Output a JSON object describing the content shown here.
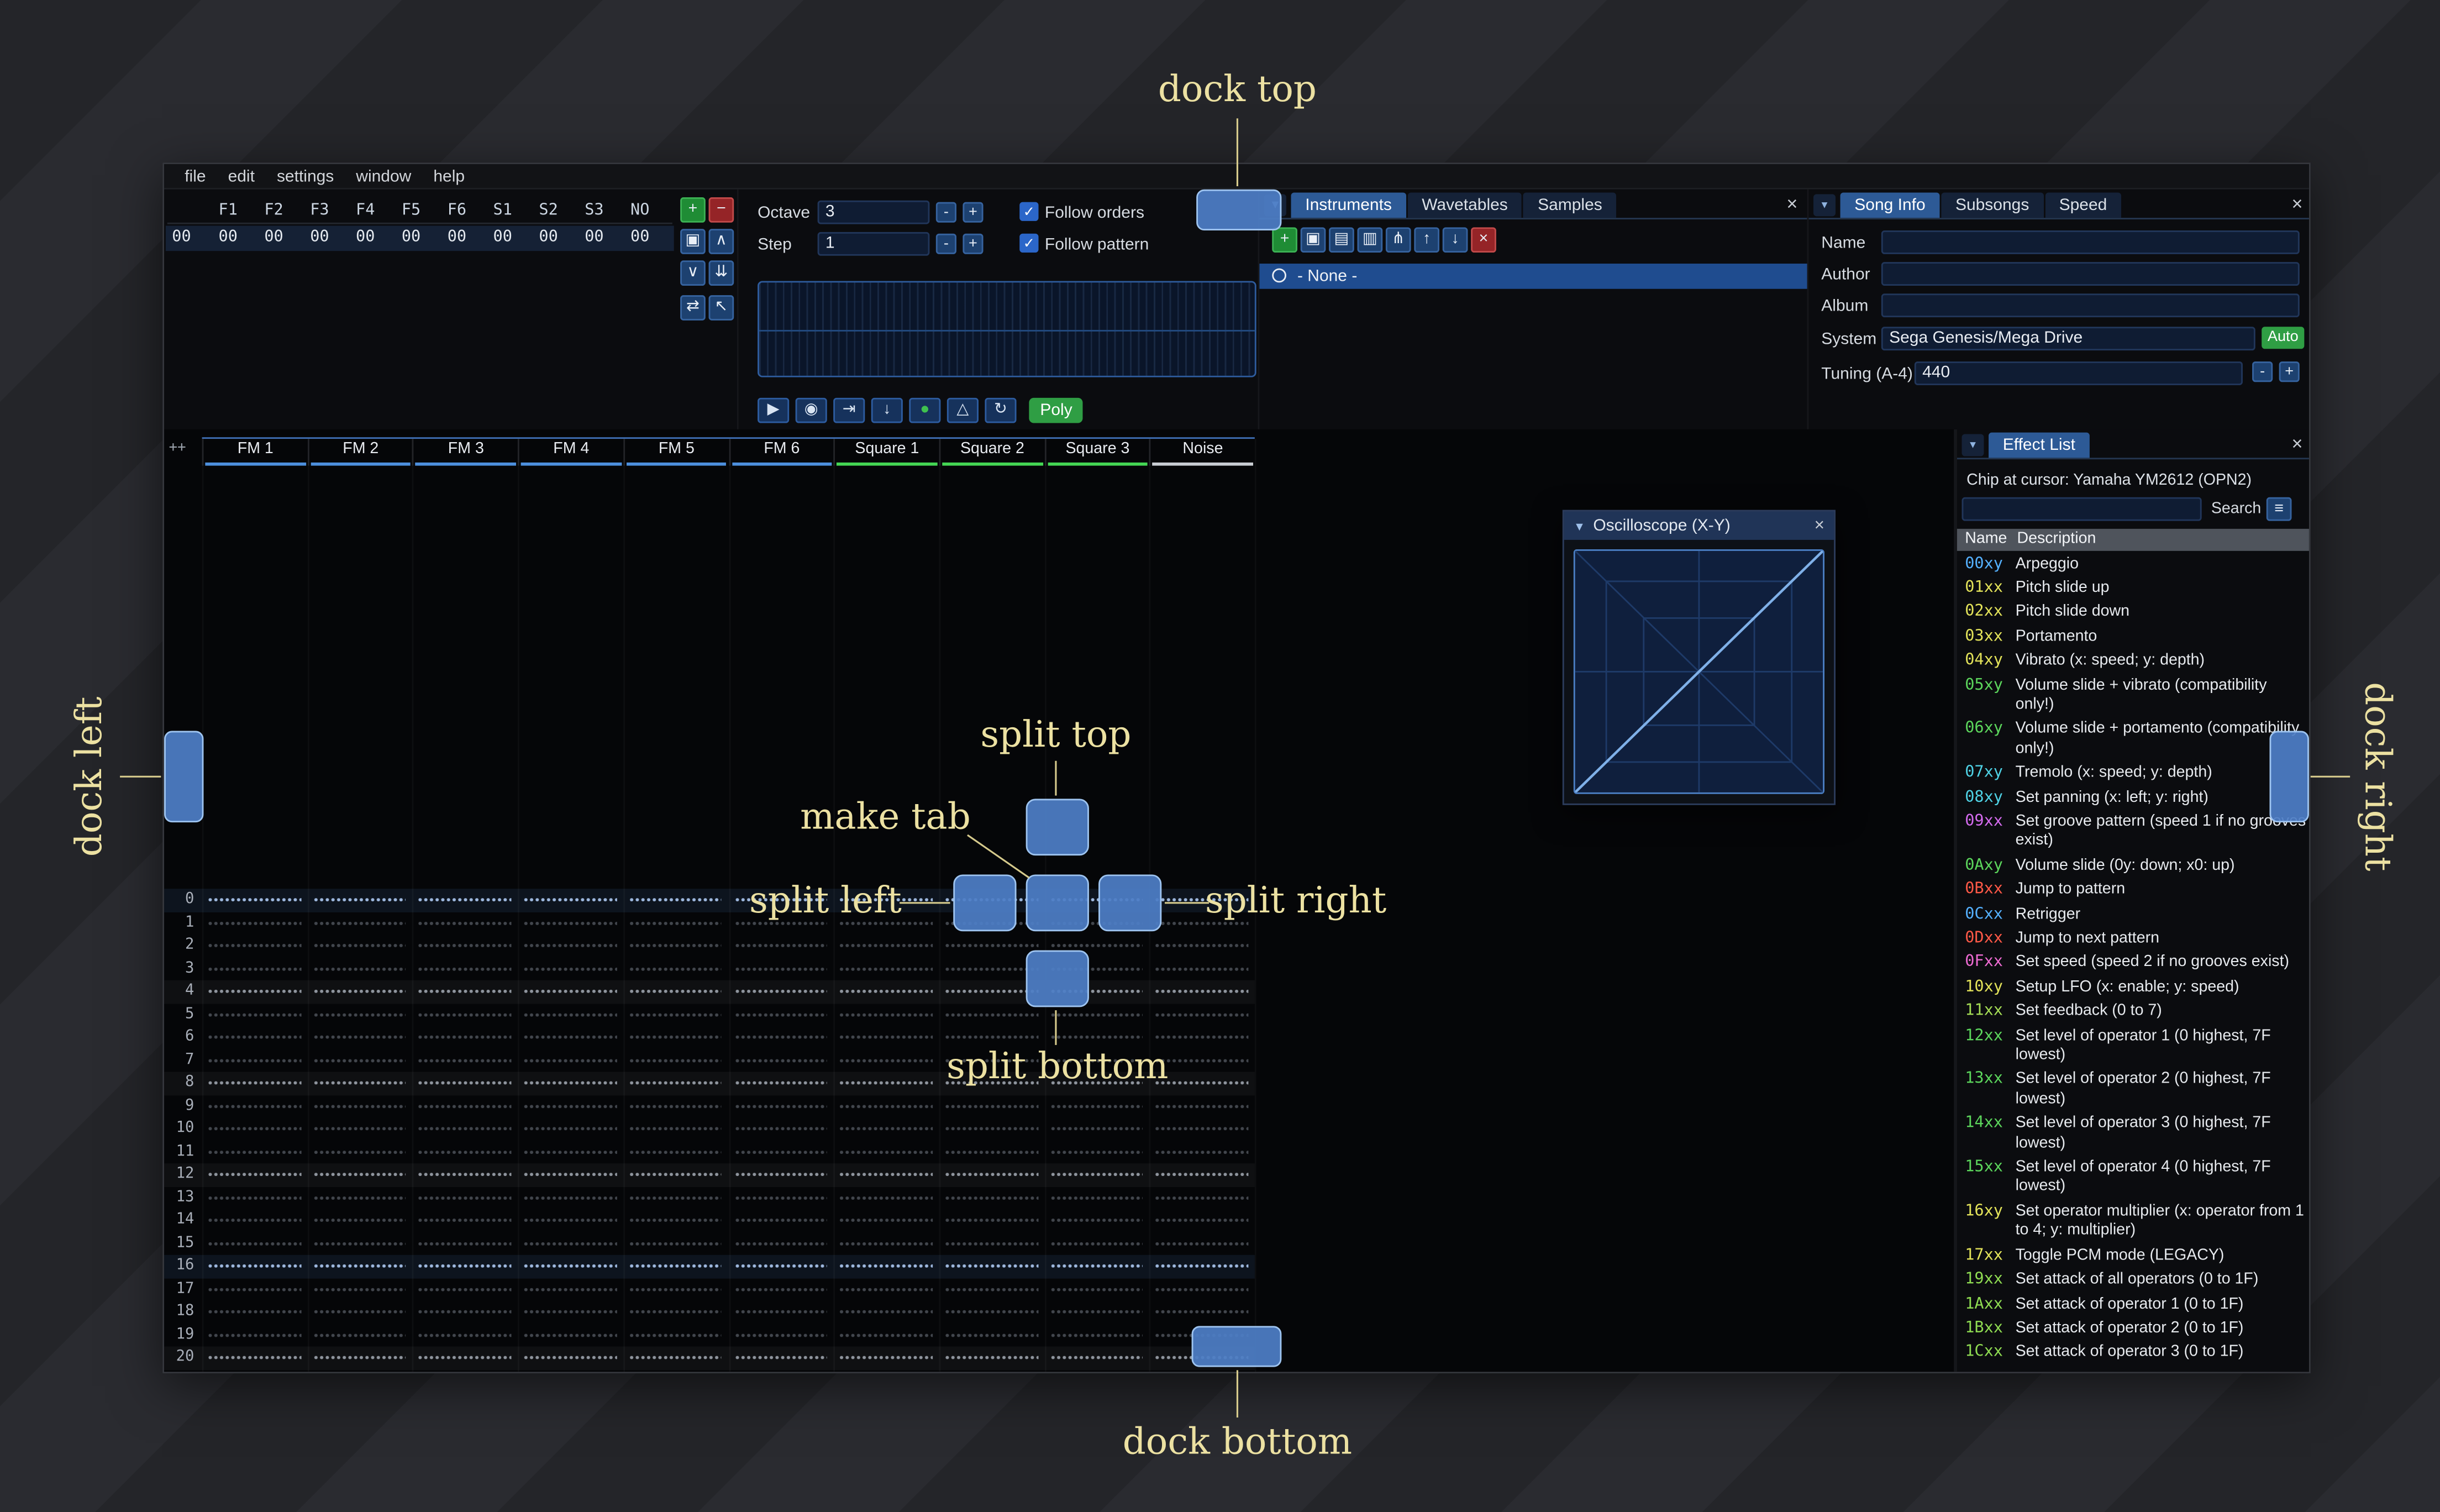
{
  "ui": {
    "close_glyph": "×",
    "caret_down": "▼",
    "collapse_arrow": "▾",
    "check": "✓",
    "menu_icon": "≡",
    "minus": "-",
    "plus": "+"
  },
  "menu": {
    "items": [
      "file",
      "edit",
      "settings",
      "window",
      "help"
    ]
  },
  "orders": {
    "row_label": "00",
    "channels": [
      "F1",
      "F2",
      "F3",
      "F4",
      "F5",
      "F6",
      "S1",
      "S2",
      "S3",
      "NO"
    ],
    "row_values": [
      "00",
      "00",
      "00",
      "00",
      "00",
      "00",
      "00",
      "00",
      "00",
      "00"
    ],
    "buttons": [
      {
        "name": "add-order-button",
        "icon": "plus-icon",
        "glyph": "+",
        "style": "green"
      },
      {
        "name": "remove-order-button",
        "icon": "minus-icon",
        "glyph": "−",
        "style": "red"
      },
      {
        "name": "duplicate-order-button",
        "icon": "duplicate-icon",
        "glyph": "▣",
        "style": "blue"
      },
      {
        "name": "move-order-up-button",
        "icon": "chevron-up-icon",
        "glyph": "∧",
        "style": "blue"
      },
      {
        "name": "move-order-down-button",
        "icon": "chevron-down-icon",
        "glyph": "∨",
        "style": "blue"
      },
      {
        "name": "duplicate-order-end-button",
        "icon": "double-down-icon",
        "glyph": "⇊",
        "style": "blue"
      },
      {
        "name": "order-change-mode-button",
        "icon": "swap-icon",
        "glyph": "⇄",
        "style": "blue"
      },
      {
        "name": "order-edit-mode-button",
        "icon": "cursor-icon",
        "glyph": "↖",
        "style": "blue"
      }
    ]
  },
  "controls": {
    "octave_label": "Octave",
    "octave_value": "3",
    "step_label": "Step",
    "step_value": "1",
    "follow_orders": "Follow orders",
    "follow_pattern": "Follow pattern",
    "transport": [
      {
        "name": "play-button",
        "icon": "play-icon",
        "glyph": "▶"
      },
      {
        "name": "stop-button",
        "icon": "stop-icon",
        "glyph": "◉"
      },
      {
        "name": "play-from-cursor-button",
        "icon": "play-to-cursor-icon",
        "glyph": "⇥"
      },
      {
        "name": "step-one-row-button",
        "icon": "arrow-down-icon",
        "glyph": "↓"
      },
      {
        "name": "record-button",
        "icon": "record-icon",
        "glyph": "●",
        "style": "record"
      },
      {
        "name": "metronome-button",
        "icon": "metronome-icon",
        "glyph": "△"
      },
      {
        "name": "repeat-pattern-button",
        "icon": "repeat-icon",
        "glyph": "↻"
      }
    ],
    "poly_label": "Poly"
  },
  "instruments": {
    "tabs": [
      "Instruments",
      "Wavetables",
      "Samples"
    ],
    "active_tab": 0,
    "toolbar": [
      {
        "name": "add-instrument-button",
        "icon": "plus-icon",
        "glyph": "+",
        "style": "green"
      },
      {
        "name": "duplicate-instrument-button",
        "icon": "duplicate-icon",
        "glyph": "▣",
        "style": "blue"
      },
      {
        "name": "open-instrument-button",
        "icon": "folder-open-icon",
        "glyph": "▤",
        "style": "blue"
      },
      {
        "name": "save-instrument-button",
        "icon": "save-icon",
        "glyph": "▥",
        "style": "blue"
      },
      {
        "name": "instrument-folders-button",
        "icon": "tree-icon",
        "glyph": "⋔",
        "style": "blue"
      },
      {
        "name": "move-instrument-up-button",
        "icon": "arrow-up-icon",
        "glyph": "↑",
        "style": "blue"
      },
      {
        "name": "move-instrument-down-button",
        "icon": "arrow-down-icon",
        "glyph": "↓",
        "style": "blue"
      },
      {
        "name": "delete-instrument-button",
        "icon": "x-icon",
        "glyph": "×",
        "style": "red"
      }
    ],
    "selected_item": "- None -"
  },
  "song": {
    "tabs": [
      "Song Info",
      "Subsongs",
      "Speed"
    ],
    "active_tab": 0,
    "name_label": "Name",
    "name_value": "",
    "author_label": "Author",
    "author_value": "",
    "album_label": "Album",
    "album_value": "",
    "system_label": "System",
    "system_value": "Sega Genesis/Mega Drive",
    "auto_label": "Auto",
    "tuning_label": "Tuning (A-4)",
    "tuning_value": "440"
  },
  "pattern": {
    "corner": "++",
    "row_count": 22,
    "channels": [
      {
        "name": "FM 1",
        "color": "#4d8fdd"
      },
      {
        "name": "FM 2",
        "color": "#4d8fdd"
      },
      {
        "name": "FM 3",
        "color": "#4d8fdd"
      },
      {
        "name": "FM 4",
        "color": "#4d8fdd"
      },
      {
        "name": "FM 5",
        "color": "#4d8fdd"
      },
      {
        "name": "FM 6",
        "color": "#4d8fdd"
      },
      {
        "name": "Square 1",
        "color": "#44d654"
      },
      {
        "name": "Square 2",
        "color": "#44d654"
      },
      {
        "name": "Square 3",
        "color": "#44d654"
      },
      {
        "name": "Noise",
        "color": "#c9cdd3"
      }
    ]
  },
  "oscilloscope": {
    "title": "Oscilloscope (X-Y)"
  },
  "effects": {
    "tab": "Effect List",
    "chip_line": "Chip at cursor: Yamaha YM2612 (OPN2)",
    "search_label": "Search",
    "search_value": "",
    "columns": [
      "Name",
      "Description"
    ],
    "items": [
      {
        "code": "00xy",
        "color": "#55b1ff",
        "desc": "Arpeggio"
      },
      {
        "code": "01xx",
        "color": "#e3e35a",
        "desc": "Pitch slide up"
      },
      {
        "code": "02xx",
        "color": "#e3e35a",
        "desc": "Pitch slide down"
      },
      {
        "code": "03xx",
        "color": "#e3e35a",
        "desc": "Portamento"
      },
      {
        "code": "04xy",
        "color": "#e3e35a",
        "desc": "Vibrato (x: speed; y: depth)"
      },
      {
        "code": "05xy",
        "color": "#5cd65c",
        "desc": "Volume slide + vibrato (compatibility only!)"
      },
      {
        "code": "06xy",
        "color": "#5cd65c",
        "desc": "Volume slide + portamento (compatibility only!)"
      },
      {
        "code": "07xy",
        "color": "#4fd2e5",
        "desc": "Tremolo (x: speed; y: depth)"
      },
      {
        "code": "08xy",
        "color": "#4fd2e5",
        "desc": "Set panning (x: left; y: right)"
      },
      {
        "code": "09xx",
        "color": "#d46bee",
        "desc": "Set groove pattern (speed 1 if no grooves exist)"
      },
      {
        "code": "0Axy",
        "color": "#5cd65c",
        "desc": "Volume slide (0y: down; x0: up)"
      },
      {
        "code": "0Bxx",
        "color": "#ff5947",
        "desc": "Jump to pattern"
      },
      {
        "code": "0Cxx",
        "color": "#55b1ff",
        "desc": "Retrigger"
      },
      {
        "code": "0Dxx",
        "color": "#ff5947",
        "desc": "Jump to next pattern"
      },
      {
        "code": "0Fxx",
        "color": "#ee6bd2",
        "desc": "Set speed (speed 2 if no grooves exist)"
      },
      {
        "code": "10xy",
        "color": "#e3e35a",
        "desc": "Setup LFO (x: enable; y: speed)"
      },
      {
        "code": "11xx",
        "color": "#a5dd55",
        "desc": "Set feedback (0 to 7)"
      },
      {
        "code": "12xx",
        "color": "#5cd65c",
        "desc": "Set level of operator 1 (0 highest, 7F lowest)"
      },
      {
        "code": "13xx",
        "color": "#5cd65c",
        "desc": "Set level of operator 2 (0 highest, 7F lowest)"
      },
      {
        "code": "14xx",
        "color": "#5cd65c",
        "desc": "Set level of operator 3 (0 highest, 7F lowest)"
      },
      {
        "code": "15xx",
        "color": "#5cd65c",
        "desc": "Set level of operator 4 (0 highest, 7F lowest)"
      },
      {
        "code": "16xy",
        "color": "#e3e35a",
        "desc": "Set operator multiplier (x: operator from 1 to 4; y: multiplier)"
      },
      {
        "code": "17xx",
        "color": "#e3e35a",
        "desc": "Toggle PCM mode (LEGACY)"
      },
      {
        "code": "19xx",
        "color": "#8fdc52",
        "desc": "Set attack of all operators (0 to 1F)"
      },
      {
        "code": "1Axx",
        "color": "#8fdc52",
        "desc": "Set attack of operator 1 (0 to 1F)"
      },
      {
        "code": "1Bxx",
        "color": "#8fdc52",
        "desc": "Set attack of operator 2 (0 to 1F)"
      },
      {
        "code": "1Cxx",
        "color": "#8fdc52",
        "desc": "Set attack of operator 3 (0 to 1F)"
      }
    ]
  },
  "dock": {
    "labels": {
      "top": "dock top",
      "left": "dock left",
      "right": "dock right",
      "bottom": "dock bottom",
      "split_top": "split top",
      "split_bottom": "split bottom",
      "split_left": "split left",
      "split_right": "split right",
      "make_tab": "make tab"
    },
    "accent_color": "#4d7ec6",
    "label_color": "#ece1a2"
  }
}
